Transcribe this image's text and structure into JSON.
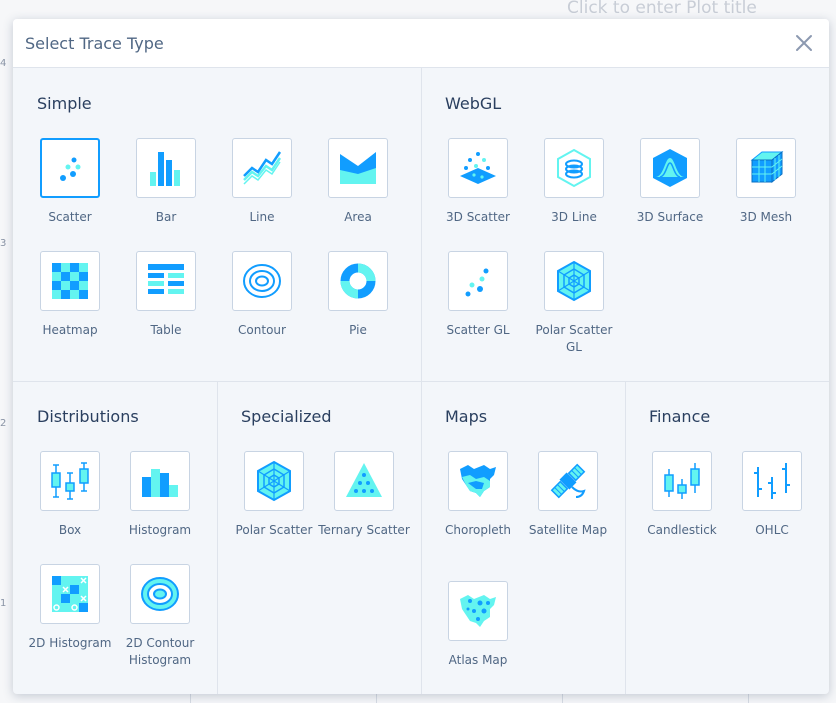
{
  "background": {
    "plot_title_placeholder": "Click to enter Plot title",
    "axis_ticks": [
      "4",
      "3",
      "2",
      "1"
    ]
  },
  "modal": {
    "title": "Select Trace Type",
    "sections": {
      "simple": {
        "title": "Simple",
        "items": [
          "Scatter",
          "Bar",
          "Line",
          "Area",
          "Heatmap",
          "Table",
          "Contour",
          "Pie"
        ]
      },
      "webgl": {
        "title": "WebGL",
        "items": [
          "3D Scatter",
          "3D Line",
          "3D Surface",
          "3D Mesh",
          "Scatter GL",
          "Polar Scatter GL"
        ]
      },
      "distributions": {
        "title": "Distributions",
        "items": [
          "Box",
          "Histogram",
          "2D Histogram",
          "2D Contour Histogram"
        ]
      },
      "specialized": {
        "title": "Specialized",
        "items": [
          "Polar Scatter",
          "Ternary Scatter"
        ]
      },
      "maps": {
        "title": "Maps",
        "items": [
          "Choropleth",
          "Satellite Map",
          "Atlas Map"
        ]
      },
      "finance": {
        "title": "Finance",
        "items": [
          "Candlestick",
          "OHLC"
        ]
      }
    },
    "selected": "Scatter"
  },
  "colors": {
    "icon_dark": "#119dff",
    "icon_light": "#63f4f0",
    "selected_border": "#119dff",
    "text": "#506784"
  }
}
